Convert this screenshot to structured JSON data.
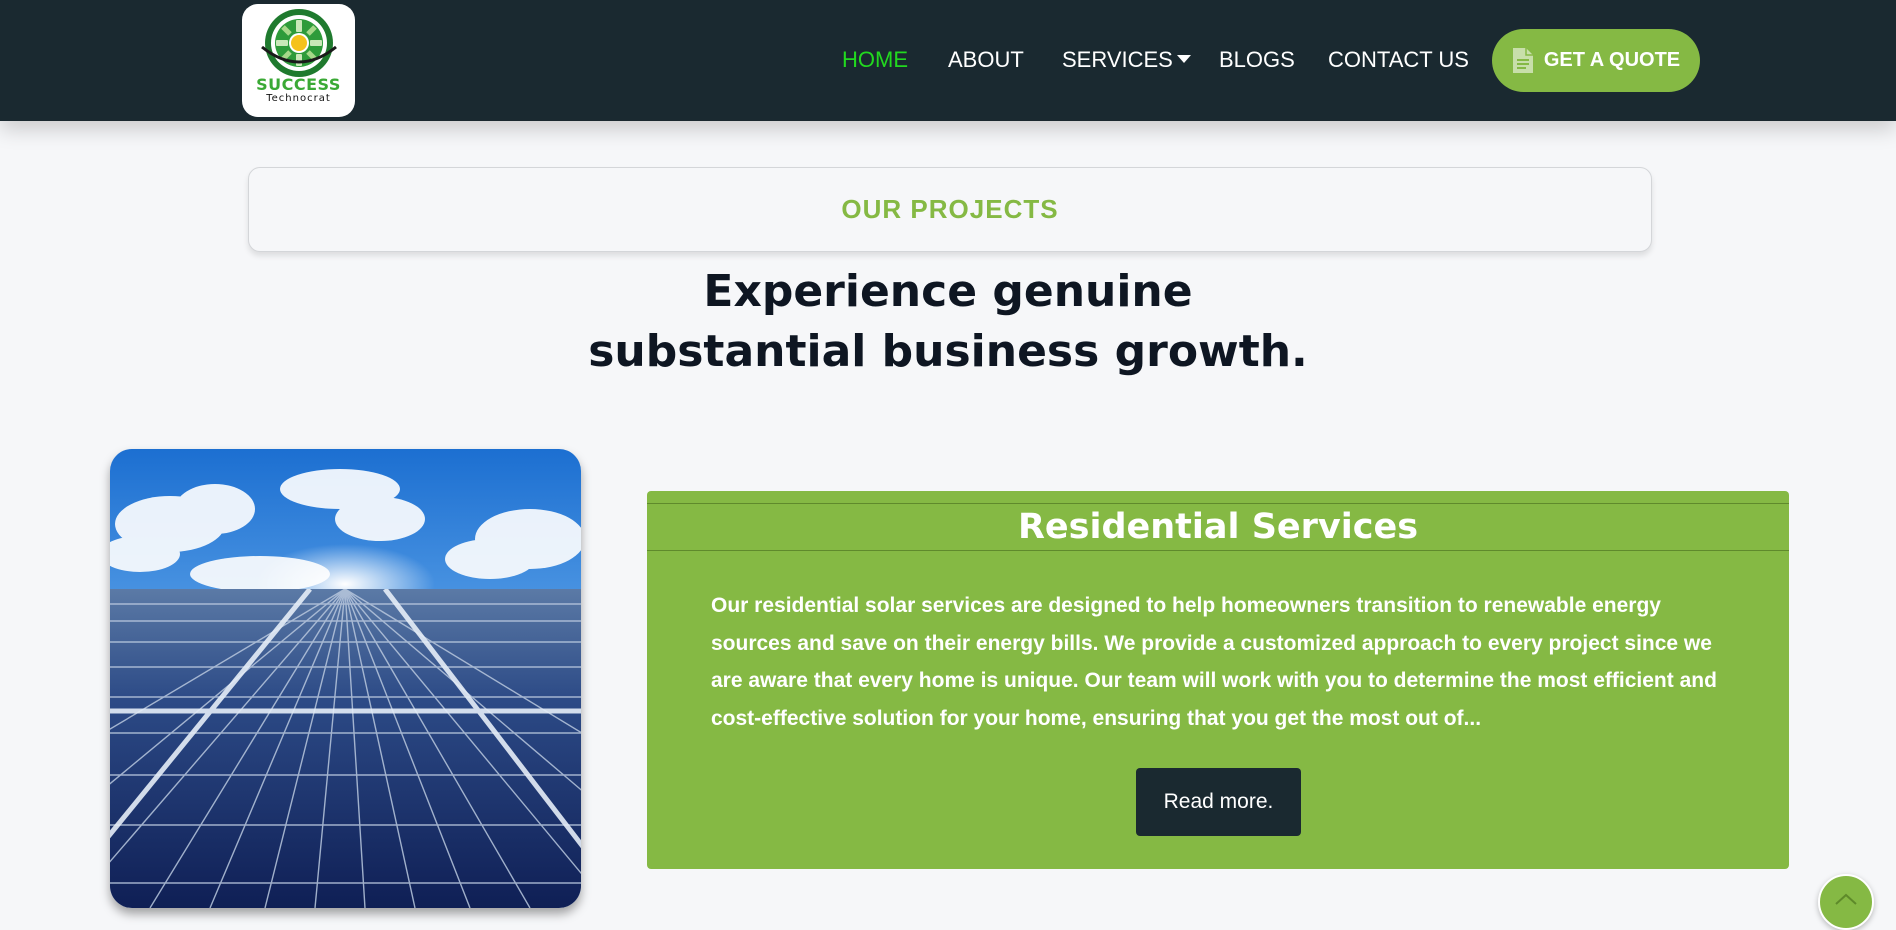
{
  "header": {
    "logo": {
      "word": "SUCCESS",
      "sub": "Technocrat"
    },
    "nav": [
      {
        "label": "HOME",
        "active": true
      },
      {
        "label": "ABOUT",
        "active": false
      },
      {
        "label": "SERVICES",
        "active": false,
        "has_dropdown": true
      },
      {
        "label": "BLOGS",
        "active": false
      },
      {
        "label": "CONTACT US",
        "active": false
      }
    ],
    "quote_button": {
      "label": "GET A QUOTE",
      "icon": "document-icon"
    }
  },
  "section": {
    "label": "OUR PROJECTS",
    "headline_line1": "Experience genuine",
    "headline_line2": "substantial business growth."
  },
  "project": {
    "image": "solar-panels-sky-image",
    "title": "Residential Services",
    "description": "Our residential solar services are designed to help homeowners transition to renewable energy sources and save on their energy bills. We provide a customized approach to every project since we are aware that every home is unique. Our team will work with you to determine the most efficient and cost-effective solution for your home, ensuring that you get the most out of...",
    "read_more": "Read more."
  },
  "scroll_top": {
    "icon": "chevron-up-icon"
  },
  "colors": {
    "header_bg": "#1a2930",
    "accent_green": "#85b944",
    "active_nav": "#22d91f",
    "headline": "#0e1622",
    "page_bg": "#f6f7f9"
  }
}
